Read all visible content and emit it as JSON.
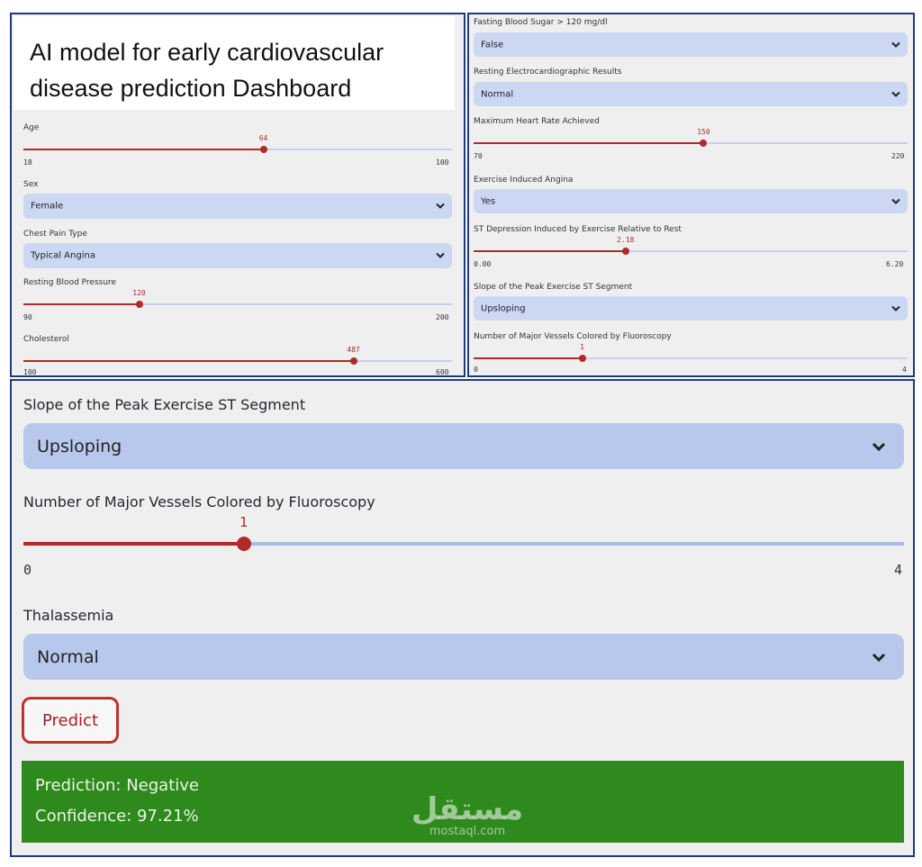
{
  "left_panel": {
    "title": "AI model for early cardiovascular disease prediction Dashboard",
    "age": {
      "label": "Age",
      "value": "64",
      "min": "18",
      "max": "100",
      "fraction": 0.56
    },
    "sex": {
      "label": "Sex",
      "value": "Female"
    },
    "chest_pain": {
      "label": "Chest Pain Type",
      "value": "Typical Angina"
    },
    "resting_bp": {
      "label": "Resting Blood Pressure",
      "value": "120",
      "min": "90",
      "max": "200",
      "fraction": 0.27
    },
    "cholesterol": {
      "label": "Cholesterol",
      "value": "487",
      "min": "100",
      "max": "600",
      "fraction": 0.77
    }
  },
  "right_panel": {
    "fasting_sugar": {
      "label": "Fasting Blood Sugar > 120 mg/dl",
      "value": "False"
    },
    "rest_ecg": {
      "label": "Resting Electrocardiographic Results",
      "value": "Normal"
    },
    "max_hr": {
      "label": "Maximum Heart Rate Achieved",
      "value": "150",
      "min": "70",
      "max": "220",
      "fraction": 0.53
    },
    "exercise_angina": {
      "label": "Exercise Induced Angina",
      "value": "Yes"
    },
    "st_depression": {
      "label": "ST Depression Induced by Exercise Relative to Rest",
      "value": "2.18",
      "min": "0.00",
      "max": "6.20",
      "fraction": 0.35
    },
    "slope": {
      "label": "Slope of the Peak Exercise ST Segment",
      "value": "Upsloping"
    },
    "vessels": {
      "label": "Number of Major Vessels Colored by Fluoroscopy",
      "value": "1",
      "min": "0",
      "max": "4",
      "fraction": 0.25
    }
  },
  "bottom_panel": {
    "slope": {
      "label": "Slope of the Peak Exercise ST Segment",
      "value": "Upsloping"
    },
    "vessels": {
      "label": "Number of Major Vessels Colored by Fluoroscopy",
      "value": "1",
      "min": "0",
      "max": "4",
      "fraction": 0.25
    },
    "thalassemia": {
      "label": "Thalassemia",
      "value": "Normal"
    },
    "predict_label": "Predict",
    "prediction": "Prediction: Negative",
    "confidence": "Confidence: 97.21%"
  },
  "watermark": {
    "arabic": "مستقل",
    "latin": "mostaql.com"
  },
  "colors": {
    "accent": "#b02a2a",
    "select_bg": "#ccd7f3",
    "success": "#2f8a1e",
    "border": "#1d3a7a"
  },
  "icons": {
    "select_chevron": "chevron-down-icon"
  }
}
